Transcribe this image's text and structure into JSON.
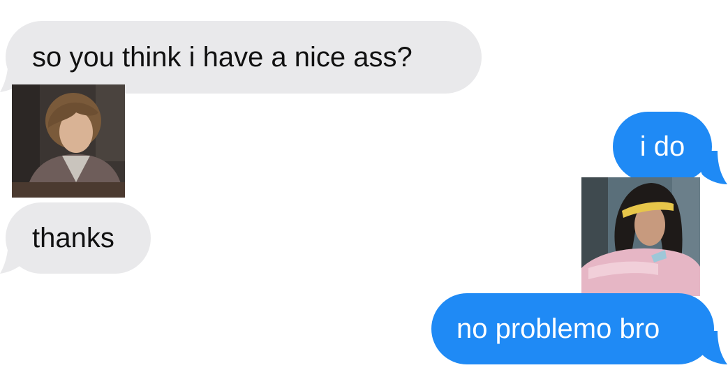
{
  "conversation": {
    "messages": [
      {
        "sender": "incoming",
        "text": "so you think i have a nice ass?"
      },
      {
        "sender": "outgoing",
        "text": "i do"
      },
      {
        "sender": "incoming",
        "text": "thanks"
      },
      {
        "sender": "outgoing",
        "text": "no problemo bro"
      }
    ]
  },
  "colors": {
    "incoming_bubble": "#e9e9eb",
    "outgoing_bubble": "#1f8af5",
    "incoming_text": "#111111",
    "outgoing_text": "#ffffff"
  },
  "images": {
    "left_photo": "photo of a young man with shaggy hair in a plaid shirt",
    "right_photo": "photo of a young person with long hair and a yellow headband"
  }
}
